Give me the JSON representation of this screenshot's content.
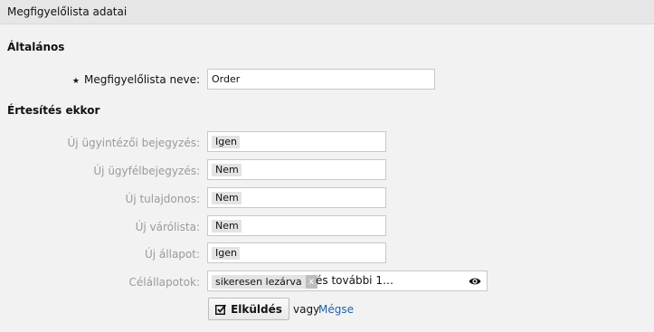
{
  "header": {
    "title": "Megfigyelőlista adatai"
  },
  "sections": {
    "general": "Általános",
    "notify": "Értesítés ekkor"
  },
  "name_field": {
    "label": "Megfigyelőlista neve:",
    "value": "Order"
  },
  "notify_rows": [
    {
      "label": "Új ügyintézői bejegyzés:",
      "value": "Igen"
    },
    {
      "label": "Új ügyfélbejegyzés:",
      "value": "Nem"
    },
    {
      "label": "Új tulajdonos:",
      "value": "Nem"
    },
    {
      "label": "Új várólista:",
      "value": "Nem"
    },
    {
      "label": "Új állapot:",
      "value": "Igen"
    }
  ],
  "target_states": {
    "label": "Célállapotok:",
    "selected": "sikeresen lezárva",
    "remove_glyph": "x",
    "more": "és további 1…"
  },
  "actions": {
    "submit_label": "Elküldés",
    "or_text": "vagy",
    "cancel_label": "Mégse"
  }
}
